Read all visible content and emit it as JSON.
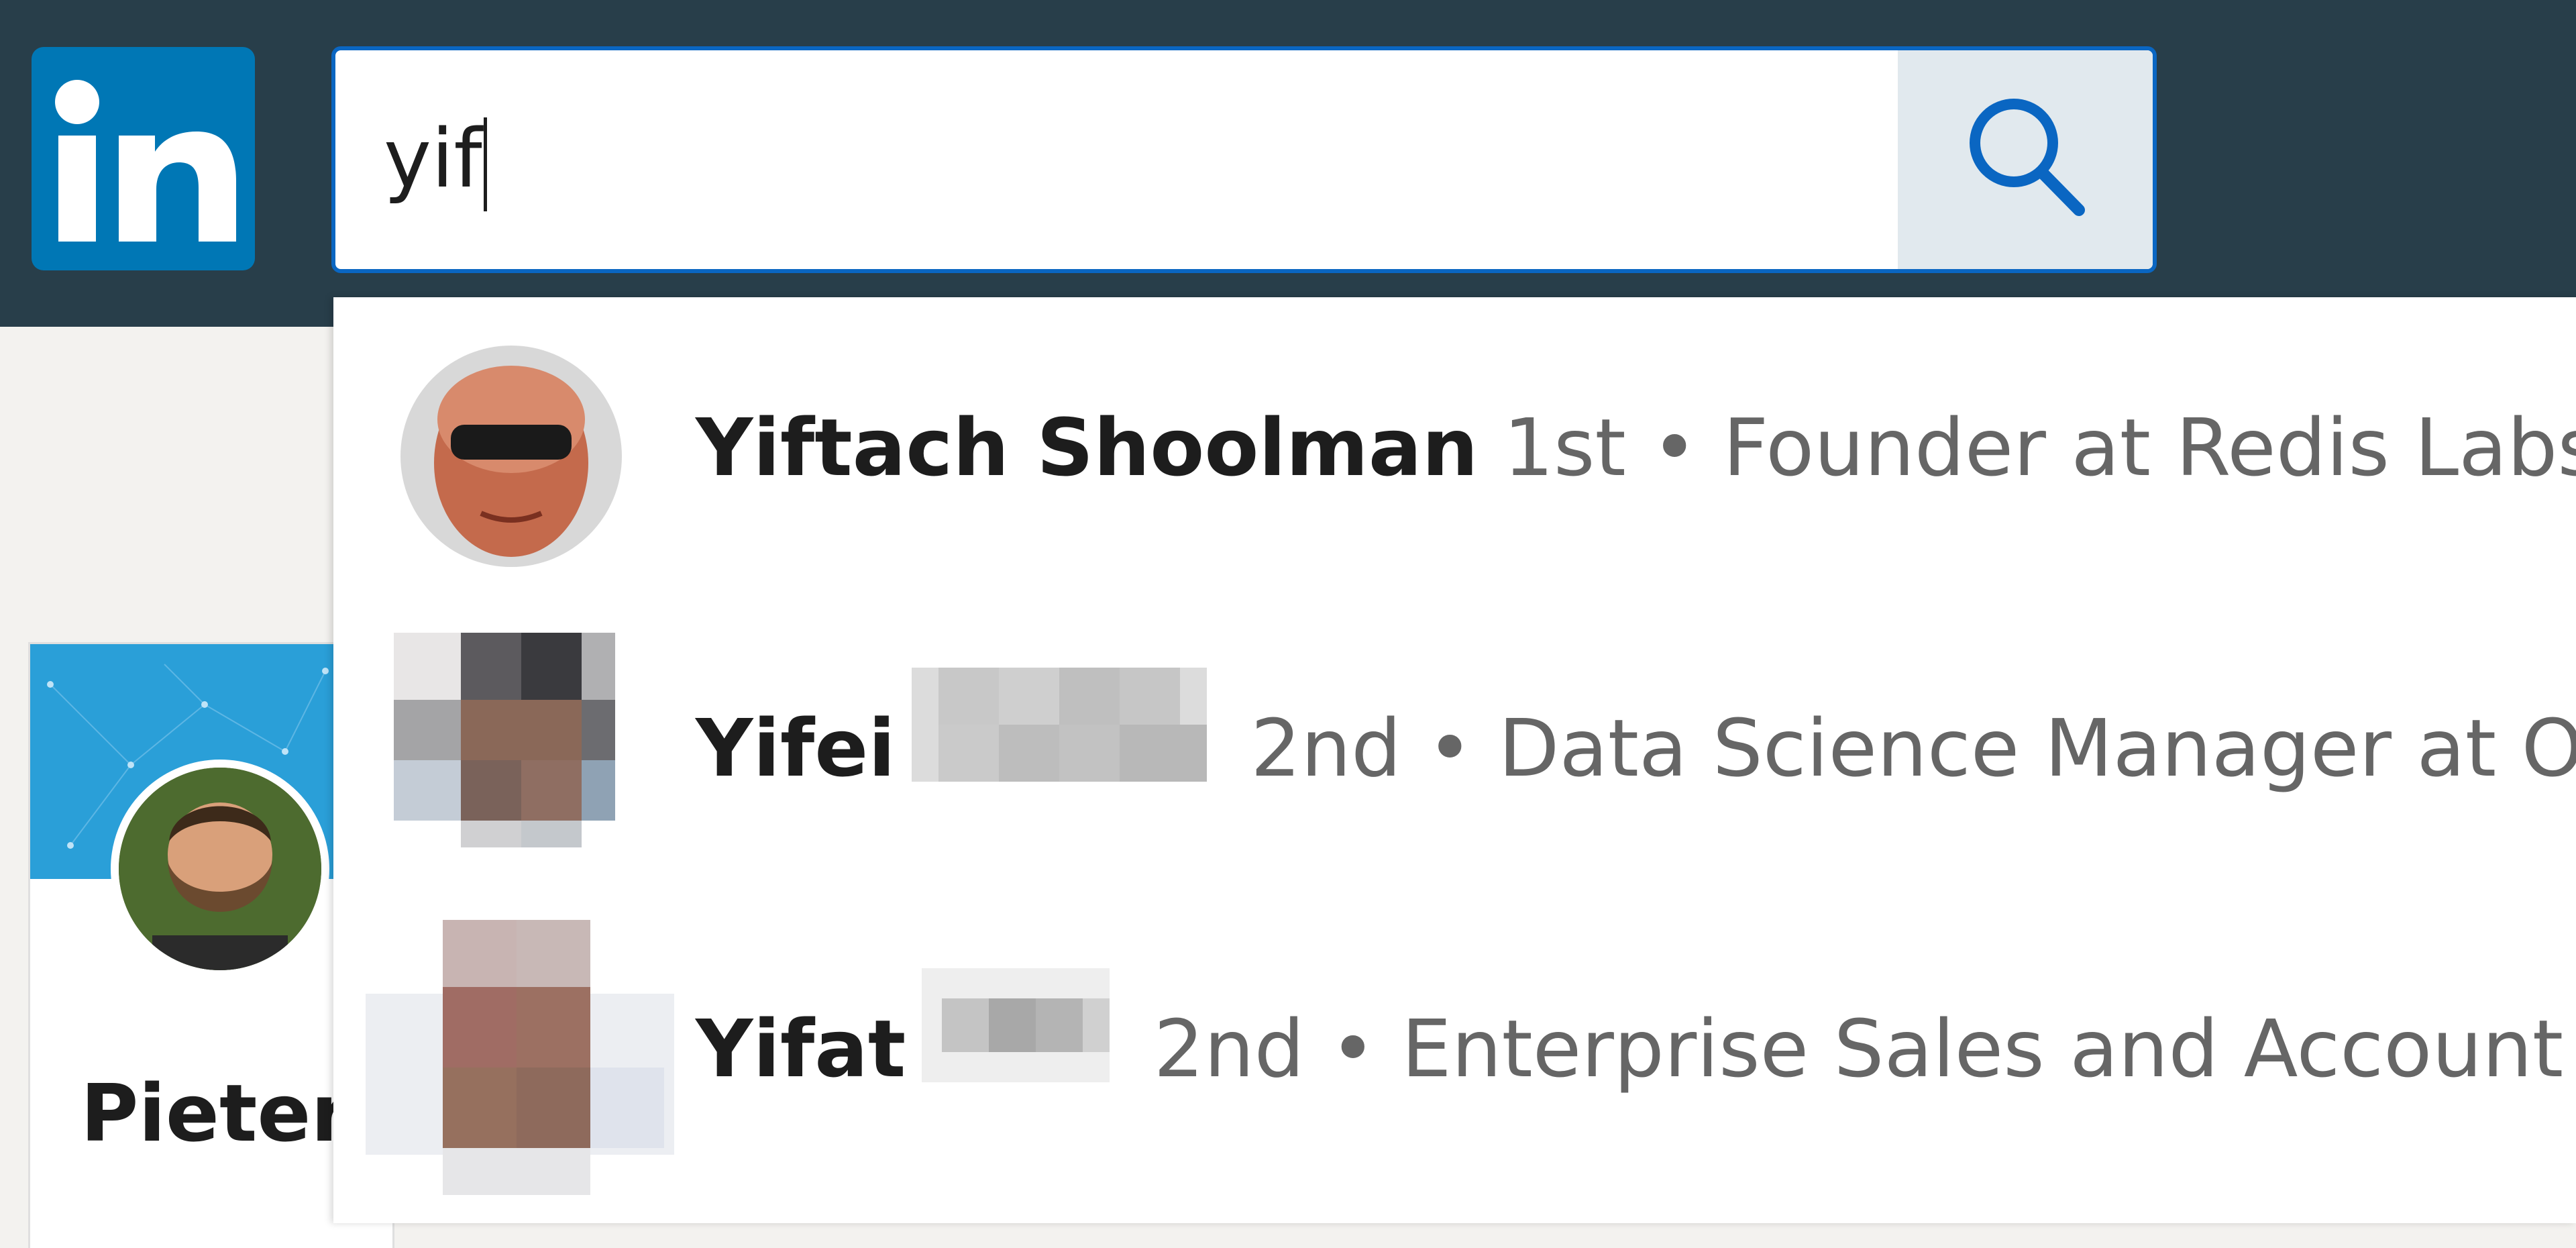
{
  "brand": {
    "logo_icon": "linkedin-logo",
    "accent": "#0077b5",
    "topbar_color": "#283e4a"
  },
  "search": {
    "value": "yif",
    "button_icon": "search-icon"
  },
  "profile_card": {
    "name": "Pieter"
  },
  "suggestions": [
    {
      "name": "Yiftach Shoolman",
      "detail": "1st • Founder at Redis Labs",
      "avatar_icon": "avatar"
    },
    {
      "name": "Yifei",
      "detail": "2nd • Data Science Manager at O",
      "avatar_icon": "avatar-pixelated",
      "surname_hidden": true
    },
    {
      "name": "Yifat",
      "detail": "2nd • Enterprise Sales and Account",
      "avatar_icon": "avatar-pixelated",
      "surname_hidden": true
    }
  ]
}
